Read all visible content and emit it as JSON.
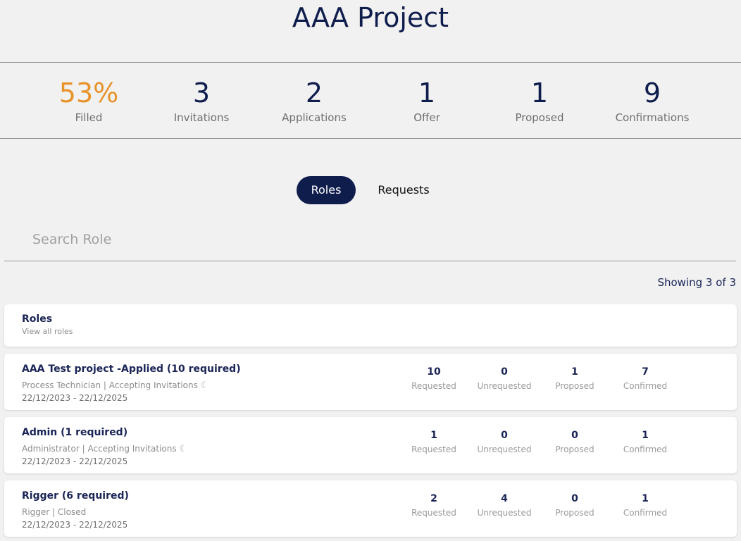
{
  "page": {
    "title": "AAA Project"
  },
  "stats": [
    {
      "value": "53%",
      "label": "Filled"
    },
    {
      "value": "3",
      "label": "Invitations"
    },
    {
      "value": "2",
      "label": "Applications"
    },
    {
      "value": "1",
      "label": "Offer"
    },
    {
      "value": "1",
      "label": "Proposed"
    },
    {
      "value": "9",
      "label": "Confirmations"
    }
  ],
  "tabs": [
    {
      "label": "Roles",
      "active": true
    },
    {
      "label": "Requests",
      "active": false
    }
  ],
  "search": {
    "placeholder": "Search Role",
    "value": ""
  },
  "showing": "Showing 3 of 3",
  "roles_header": {
    "title": "Roles",
    "link": "View all roles"
  },
  "metric_labels": [
    "Requested",
    "Unrequested",
    "Proposed",
    "Confirmed"
  ],
  "roles": [
    {
      "name": "AAA Test project -Applied (10 required)",
      "subtitle": "Process Technician | Accepting Invitations",
      "status_icon": "moon-icon",
      "dates": "22/12/2023 - 22/12/2025",
      "requested": "10",
      "unrequested": "0",
      "proposed": "1",
      "confirmed": "7"
    },
    {
      "name": "Admin (1 required)",
      "subtitle": "Administrator | Accepting Invitations",
      "status_icon": "moon-icon",
      "dates": "22/12/2023 - 22/12/2025",
      "requested": "1",
      "unrequested": "0",
      "proposed": "0",
      "confirmed": "1"
    },
    {
      "name": "Rigger (6 required)",
      "subtitle": "Rigger | Closed",
      "status_icon": "",
      "dates": "22/12/2023 - 22/12/2025",
      "requested": "2",
      "unrequested": "4",
      "proposed": "0",
      "confirmed": "1"
    }
  ],
  "colors": {
    "primary": "#0f1d4d",
    "accent": "#e8922a",
    "background": "#f1f1f1"
  }
}
